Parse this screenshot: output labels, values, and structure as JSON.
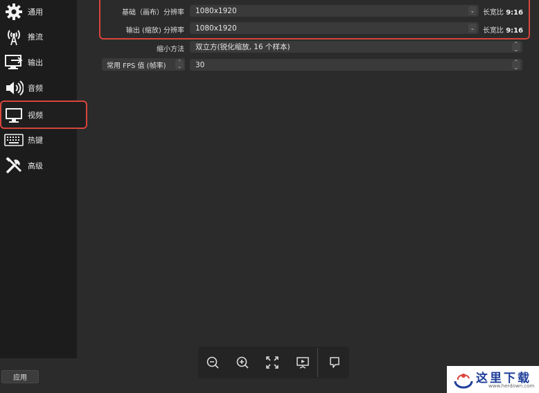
{
  "sidebar": {
    "items": [
      {
        "label": "通用",
        "icon": "gear-icon"
      },
      {
        "label": "推流",
        "icon": "broadcast-icon"
      },
      {
        "label": "输出",
        "icon": "output-icon"
      },
      {
        "label": "音频",
        "icon": "speaker-icon"
      },
      {
        "label": "视频",
        "icon": "monitor-icon",
        "active": true
      },
      {
        "label": "热键",
        "icon": "keyboard-icon"
      },
      {
        "label": "高级",
        "icon": "tools-icon"
      }
    ]
  },
  "video": {
    "base_resolution": {
      "label": "基础（画布）分辨率",
      "value": "1080x1920",
      "ratio_label": "长宽比",
      "ratio_value": "9:16"
    },
    "output_resolution": {
      "label": "输出 (缩放) 分辨率",
      "value": "1080x1920",
      "ratio_label": "长宽比",
      "ratio_value": "9:16"
    },
    "downscale": {
      "label": "缩小方法",
      "value": "双立方(锐化缩放, 16 个样本)"
    },
    "fps": {
      "type_label": "常用 FPS 值 (帧率)",
      "value": "30"
    }
  },
  "apply_label": "应用",
  "toolbar": {
    "buttons": [
      "zoom-out-icon",
      "zoom-in-icon",
      "fit-screen-icon",
      "preview-icon",
      "comment-icon"
    ]
  },
  "watermark": {
    "text": "这里下载",
    "url": "www.herdown.com"
  },
  "colors": {
    "highlight": "#d9453c",
    "background": "#2b2b2b",
    "sidebar": "#1c1c1c"
  }
}
